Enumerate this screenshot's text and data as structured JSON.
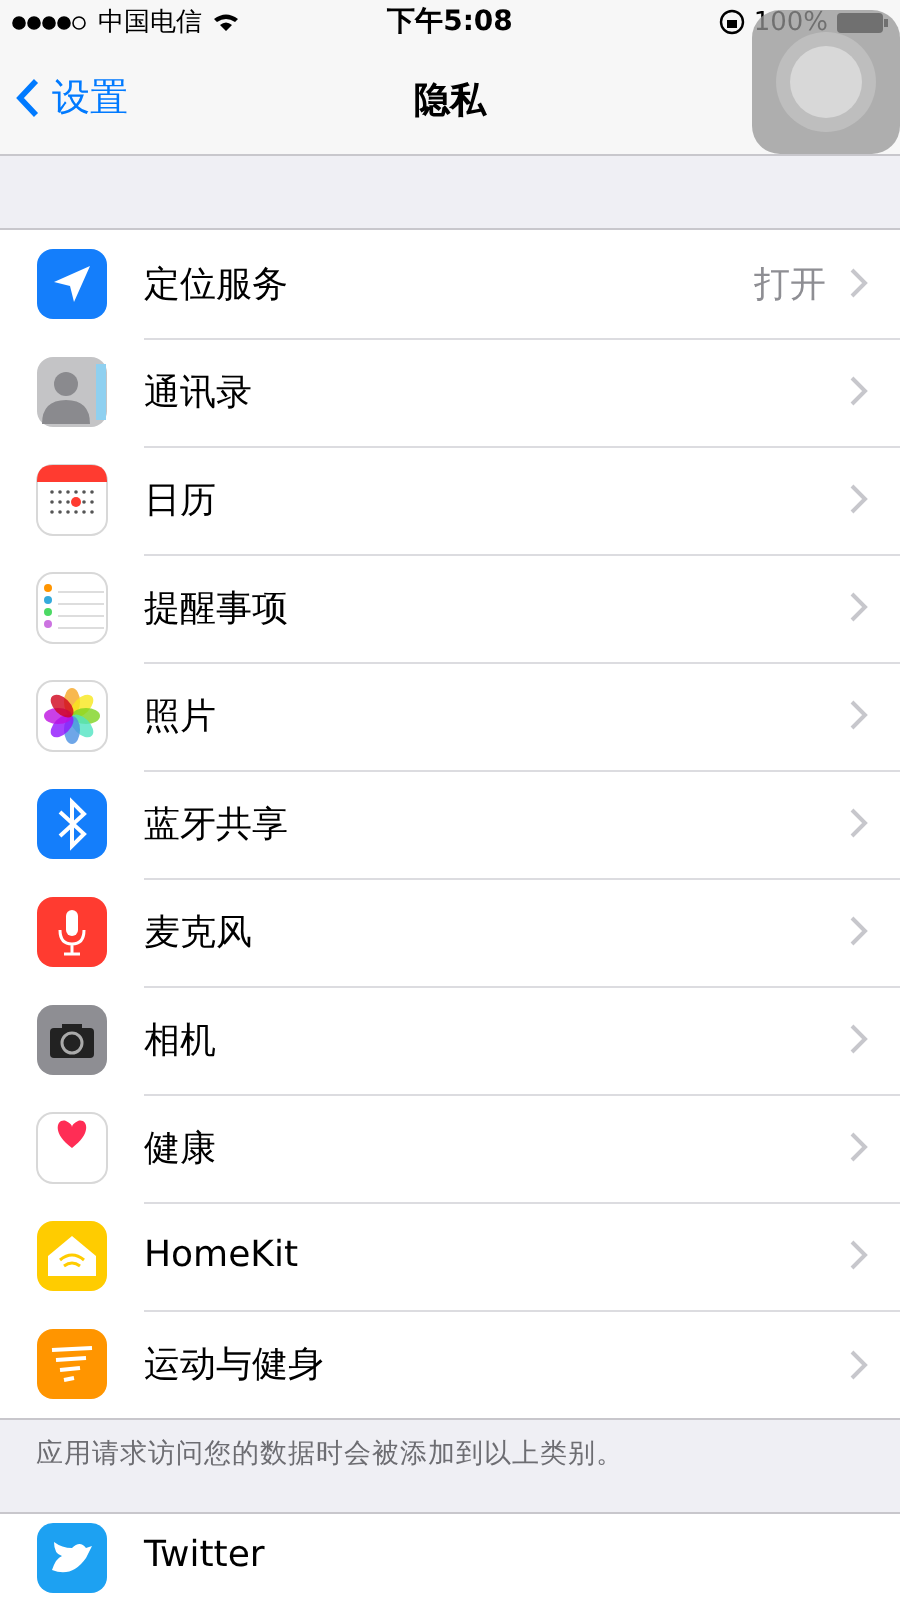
{
  "status_bar": {
    "carrier": "中国电信",
    "time": "下午5:08",
    "battery": "100%"
  },
  "nav": {
    "back": "设置",
    "title": "隐私"
  },
  "rows": [
    {
      "kind": "location",
      "label": "定位服务",
      "value": "打开"
    },
    {
      "kind": "contacts",
      "label": "通讯录"
    },
    {
      "kind": "calendar",
      "label": "日历"
    },
    {
      "kind": "reminders",
      "label": "提醒事项"
    },
    {
      "kind": "photos",
      "label": "照片"
    },
    {
      "kind": "bluetooth",
      "label": "蓝牙共享"
    },
    {
      "kind": "microphone",
      "label": "麦克风"
    },
    {
      "kind": "camera",
      "label": "相机"
    },
    {
      "kind": "health",
      "label": "健康"
    },
    {
      "kind": "homekit",
      "label": "HomeKit"
    },
    {
      "kind": "motion",
      "label": "运动与健身"
    }
  ],
  "footer": "应用请求访问您的数据时会被添加到以上类别。",
  "apps": [
    {
      "kind": "twitter",
      "label": "Twitter"
    }
  ]
}
